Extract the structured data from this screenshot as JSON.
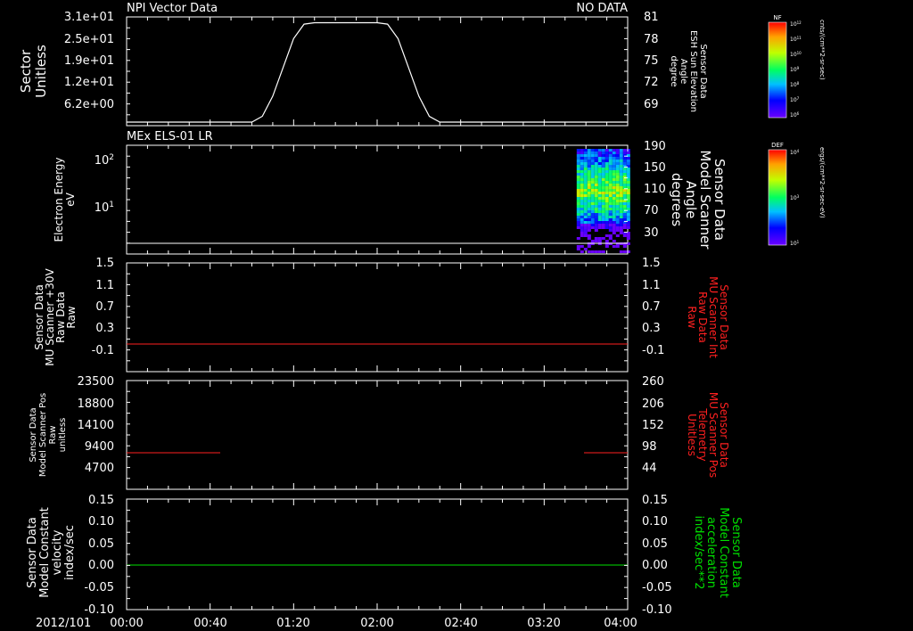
{
  "date": "2012/101",
  "time_ticks": [
    "00:00",
    "00:40",
    "01:20",
    "02:00",
    "02:40",
    "03:20",
    "04:00"
  ],
  "colors": {
    "white": "#ffffff",
    "red": "#ff2020",
    "green": "#00e000"
  },
  "panels": [
    {
      "title": "NPI Vector Data",
      "status": "NO DATA",
      "left_label": [
        "Sector",
        "Unitless"
      ],
      "left_ticks": [
        "3.1e+01",
        "2.5e+01",
        "1.9e+01",
        "1.2e+01",
        "6.2e+00"
      ],
      "right_ticks": [
        "81",
        "78",
        "75",
        "72",
        "69"
      ],
      "right_label": [
        "Sensor Data",
        "ESH Sun Elevation",
        "Angle",
        "degree"
      ],
      "right_label_color": "#ffffff"
    },
    {
      "title": "MEx ELS-01 LR",
      "left_label": [
        "Electron Energy",
        "eV"
      ],
      "left_ticks": [
        "10",
        "10"
      ],
      "left_tick_exp": [
        "2",
        "1"
      ],
      "right_ticks": [
        "190",
        "150",
        "110",
        "70",
        "30"
      ],
      "right_label": [
        "Sensor Data",
        "Model Scanner",
        "Angle",
        "degrees"
      ],
      "right_label_color": "#ffffff"
    },
    {
      "left_label": [
        "Sensor Data",
        "MU Scanner +30V",
        "Raw Data",
        "Raw"
      ],
      "left_ticks": [
        "1.5",
        "1.1",
        "0.7",
        "0.3",
        "-0.1"
      ],
      "right_ticks": [
        "1.5",
        "1.1",
        "0.7",
        "0.3",
        "-0.1"
      ],
      "right_label": [
        "Sensor Data",
        "MU Scanner Int",
        "Raw Data",
        "Raw"
      ],
      "right_label_color": "#ff2020"
    },
    {
      "left_label": [
        "Sensor Data",
        "Model Scanner Pos",
        "Raw",
        "unitless"
      ],
      "left_ticks": [
        "23500",
        "18800",
        "14100",
        "9400",
        "4700"
      ],
      "right_ticks": [
        "260",
        "206",
        "152",
        "98",
        "44"
      ],
      "right_label": [
        "Sensor Data",
        "MU Scanner Pos",
        "Telemetry",
        "Unitless"
      ],
      "right_label_color": "#ff2020"
    },
    {
      "left_label": [
        "Sensor Data",
        "Model Constant",
        "velocity",
        "index/sec"
      ],
      "left_ticks": [
        "0.15",
        "0.10",
        "0.05",
        "0.00",
        "-0.05",
        "-0.10"
      ],
      "right_ticks": [
        "0.15",
        "0.10",
        "0.05",
        "0.00",
        "-0.05",
        "-0.10"
      ],
      "right_label": [
        "Sensor Data",
        "Model Constant",
        "acceleration",
        "index/sec**2"
      ],
      "right_label_color": "#00e000"
    }
  ],
  "colorbars": [
    {
      "name": "NF",
      "ticks": [
        "10",
        "10",
        "10",
        "10",
        "10",
        "10",
        "10"
      ],
      "exps": [
        "12",
        "11",
        "10",
        "9",
        "8",
        "7",
        "6"
      ],
      "units": "cnts/(cm**2-sr-sec)"
    },
    {
      "name": "DEF",
      "ticks": [
        "10",
        "10",
        "10"
      ],
      "exps": [
        "4",
        "3",
        "1"
      ],
      "units": "ergs/(cm**2-sr-sec-eV)"
    }
  ],
  "chart_data": [
    {
      "type": "line",
      "title": "NPI Vector Data",
      "ylabel": "Sector Unitless",
      "y2label": "Sensor Data ESH Sun Elevation Angle degree",
      "xlim": [
        "00:00",
        "04:00"
      ],
      "ylim": [
        0,
        31
      ],
      "series": [
        {
          "name": "Sensor Data ESH Sun Elevation Angle",
          "axis": "right",
          "x": [
            "00:00",
            "01:00",
            "01:05",
            "01:10",
            "01:15",
            "01:20",
            "01:25",
            "01:30",
            "02:00",
            "02:05",
            "02:10",
            "02:15",
            "02:20",
            "02:25",
            "02:30",
            "04:00"
          ],
          "y": [
            66.4,
            66.4,
            67.2,
            70.0,
            74.0,
            78.0,
            80.0,
            80.2,
            80.2,
            80.0,
            78.0,
            74.0,
            70.0,
            67.2,
            66.4,
            66.4
          ]
        }
      ]
    },
    {
      "type": "heatmap",
      "title": "MEx ELS-01 LR",
      "ylabel": "Electron Energy eV",
      "y2label": "Sensor Data Model Scanner Angle degrees",
      "xlim": [
        "00:00",
        "04:00"
      ],
      "data_interval": [
        "03:36",
        "04:00"
      ],
      "ylim_right": [
        10,
        190
      ]
    },
    {
      "type": "line",
      "ylabel": "Sensor Data MU Scanner +30V Raw Data Raw",
      "y2label": "Sensor Data MU Scanner Int Raw Data Raw",
      "ylim": [
        -0.3,
        1.5
      ],
      "series": [
        {
          "name": "Sensor Data MU Scanner Int Raw Data",
          "x": [
            "00:00",
            "04:00"
          ],
          "y": [
            0.0,
            0.0
          ]
        }
      ]
    },
    {
      "type": "line",
      "ylabel": "Sensor Data Model Scanner Pos Raw unitless",
      "y2label": "Sensor Data MU Scanner Pos Telemetry Unitless",
      "ylim": [
        0,
        23500
      ],
      "series": [
        {
          "name": "Sensor Data MU Scanner Pos Telemetry",
          "segments": [
            {
              "x": [
                "00:00",
                "00:45"
              ],
              "y": [
                8200,
                8200
              ]
            },
            {
              "x": [
                "03:30",
                "04:00"
              ],
              "y": [
                8200,
                8200
              ]
            }
          ]
        }
      ]
    },
    {
      "type": "line",
      "ylabel": "Sensor Data Model Constant velocity index/sec",
      "y2label": "Sensor Data Model Constant acceleration index/sec**2",
      "ylim": [
        -0.1,
        0.15
      ],
      "series": [
        {
          "name": "Sensor Data Model Constant acceleration",
          "x": [
            "00:00",
            "04:00"
          ],
          "y": [
            0.0,
            0.0
          ]
        }
      ]
    }
  ]
}
